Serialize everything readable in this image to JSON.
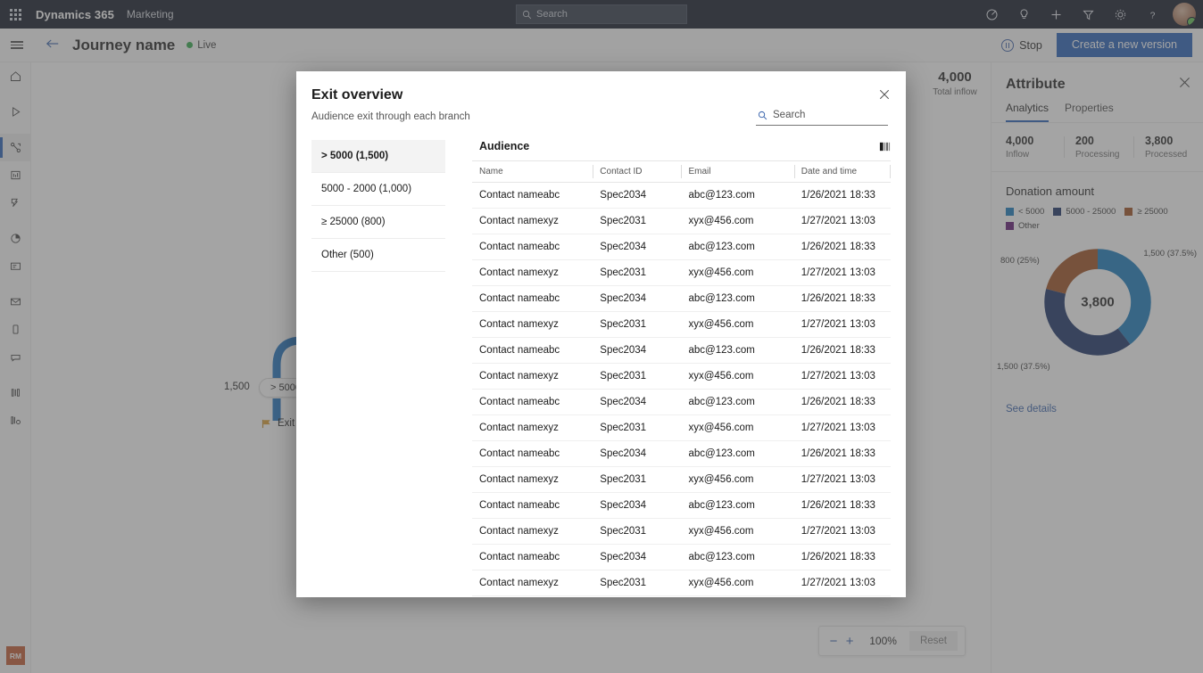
{
  "suite": {
    "waffle_icon": "app-launcher-icon",
    "brand": "Dynamics 365",
    "app": "Marketing",
    "search_placeholder": "Search",
    "icons": [
      {
        "name": "target-icon",
        "glyph": "◎"
      },
      {
        "name": "lightbulb-icon",
        "glyph": "♀"
      },
      {
        "name": "plus-icon",
        "glyph": "+"
      },
      {
        "name": "filter-icon",
        "glyph": "▽"
      },
      {
        "name": "gear-icon",
        "glyph": "✲"
      },
      {
        "name": "help-icon",
        "glyph": "?"
      }
    ]
  },
  "command_bar": {
    "hamburger_icon": "site-map-icon",
    "back_icon": "back-arrow-icon",
    "title": "Journey name",
    "status": "Live",
    "stop_label": "Stop",
    "primary_label": "Create a new version"
  },
  "rail": {
    "items": [
      {
        "name": "sidebar-item-home",
        "label": "Home"
      },
      {
        "name": "sidebar-item-recent",
        "label": "Recent"
      },
      {
        "name": "sidebar-item-journeys",
        "label": "Journeys"
      },
      {
        "name": "sidebar-item-insights",
        "label": "Insights"
      },
      {
        "name": "sidebar-item-workflows",
        "label": "Workflows"
      },
      {
        "name": "sidebar-item-analytics",
        "label": "Analytics"
      },
      {
        "name": "sidebar-item-forms",
        "label": "Forms"
      },
      {
        "name": "sidebar-item-email",
        "label": "Email"
      },
      {
        "name": "sidebar-item-mobile",
        "label": "Mobile"
      },
      {
        "name": "sidebar-item-messages",
        "label": "Messages"
      },
      {
        "name": "sidebar-item-segments",
        "label": "Segments"
      },
      {
        "name": "sidebar-item-reports",
        "label": "Reports"
      }
    ],
    "avatar_initials": "RM"
  },
  "canvas": {
    "branch_count": "1,500",
    "branch_label": "> 5000",
    "exit_label": "Exit",
    "zoom": {
      "minus_label": "−",
      "plus_label": "+",
      "level": "100%",
      "reset_label": "Reset"
    }
  },
  "inflow": {
    "value": "4,000",
    "label": "Total inflow"
  },
  "right_panel": {
    "title": "Attribute",
    "close_icon": "close-icon",
    "tabs": [
      {
        "label": "Analytics",
        "active": true
      },
      {
        "label": "Properties",
        "active": false
      }
    ],
    "stats": [
      {
        "value": "4,000",
        "label": "Inflow"
      },
      {
        "value": "200",
        "label": "Processing"
      },
      {
        "value": "3,800",
        "label": "Processed"
      }
    ],
    "section_title": "Donation amount",
    "see_details": "See details"
  },
  "chart_data": {
    "type": "pie",
    "title": "Donation amount",
    "center_label": "3,800",
    "legend_position": "top",
    "categories": [
      "< 5000",
      "5000 - 25000",
      "≥ 25000",
      "Other"
    ],
    "values": [
      1500,
      1500,
      800,
      0
    ],
    "percents": [
      "37.5%",
      "37.5%",
      "25%",
      "0%"
    ],
    "colors": [
      "#1077bb",
      "#122a63",
      "#9c4a1a",
      "#5c1070"
    ],
    "labels": [
      "1,500 (37.5%)",
      "1,500 (37.5%)",
      "800 (25%)"
    ],
    "legend": [
      {
        "label": "< 5000",
        "color": "#1077bb"
      },
      {
        "label": "5000 - 25000",
        "color": "#122a63"
      },
      {
        "label": "≥ 25000",
        "color": "#9c4a1a"
      },
      {
        "label": "Other",
        "color": "#5c1070"
      }
    ]
  },
  "modal": {
    "title": "Exit overview",
    "subtitle": "Audience exit through each branch",
    "close_icon": "close-icon",
    "search_placeholder": "Search",
    "branches": [
      {
        "label": "> 5000 (1,500)",
        "selected": true
      },
      {
        "label": "5000 - 2000 (1,000)",
        "selected": false
      },
      {
        "label": "≥ 25000 (800)",
        "selected": false
      },
      {
        "label": "Other (500)",
        "selected": false
      }
    ],
    "audience": {
      "title": "Audience",
      "columns_icon": "column-settings-icon",
      "columns": [
        "Name",
        "Contact ID",
        "Email",
        "Date and time"
      ],
      "rows": [
        [
          "Contact nameabc",
          "Spec2034",
          "abc@123.com",
          "1/26/2021 18:33"
        ],
        [
          "Contact namexyz",
          "Spec2031",
          "xyx@456.com",
          "1/27/2021 13:03"
        ],
        [
          "Contact nameabc",
          "Spec2034",
          "abc@123.com",
          "1/26/2021 18:33"
        ],
        [
          "Contact namexyz",
          "Spec2031",
          "xyx@456.com",
          "1/27/2021 13:03"
        ],
        [
          "Contact nameabc",
          "Spec2034",
          "abc@123.com",
          "1/26/2021 18:33"
        ],
        [
          "Contact namexyz",
          "Spec2031",
          "xyx@456.com",
          "1/27/2021 13:03"
        ],
        [
          "Contact nameabc",
          "Spec2034",
          "abc@123.com",
          "1/26/2021 18:33"
        ],
        [
          "Contact namexyz",
          "Spec2031",
          "xyx@456.com",
          "1/27/2021 13:03"
        ],
        [
          "Contact nameabc",
          "Spec2034",
          "abc@123.com",
          "1/26/2021 18:33"
        ],
        [
          "Contact namexyz",
          "Spec2031",
          "xyx@456.com",
          "1/27/2021 13:03"
        ],
        [
          "Contact nameabc",
          "Spec2034",
          "abc@123.com",
          "1/26/2021 18:33"
        ],
        [
          "Contact namexyz",
          "Spec2031",
          "xyx@456.com",
          "1/27/2021 13:03"
        ],
        [
          "Contact nameabc",
          "Spec2034",
          "abc@123.com",
          "1/26/2021 18:33"
        ],
        [
          "Contact namexyz",
          "Spec2031",
          "xyx@456.com",
          "1/27/2021 13:03"
        ],
        [
          "Contact nameabc",
          "Spec2034",
          "abc@123.com",
          "1/26/2021 18:33"
        ],
        [
          "Contact namexyz",
          "Spec2031",
          "xyx@456.com",
          "1/27/2021 13:03"
        ]
      ]
    }
  }
}
